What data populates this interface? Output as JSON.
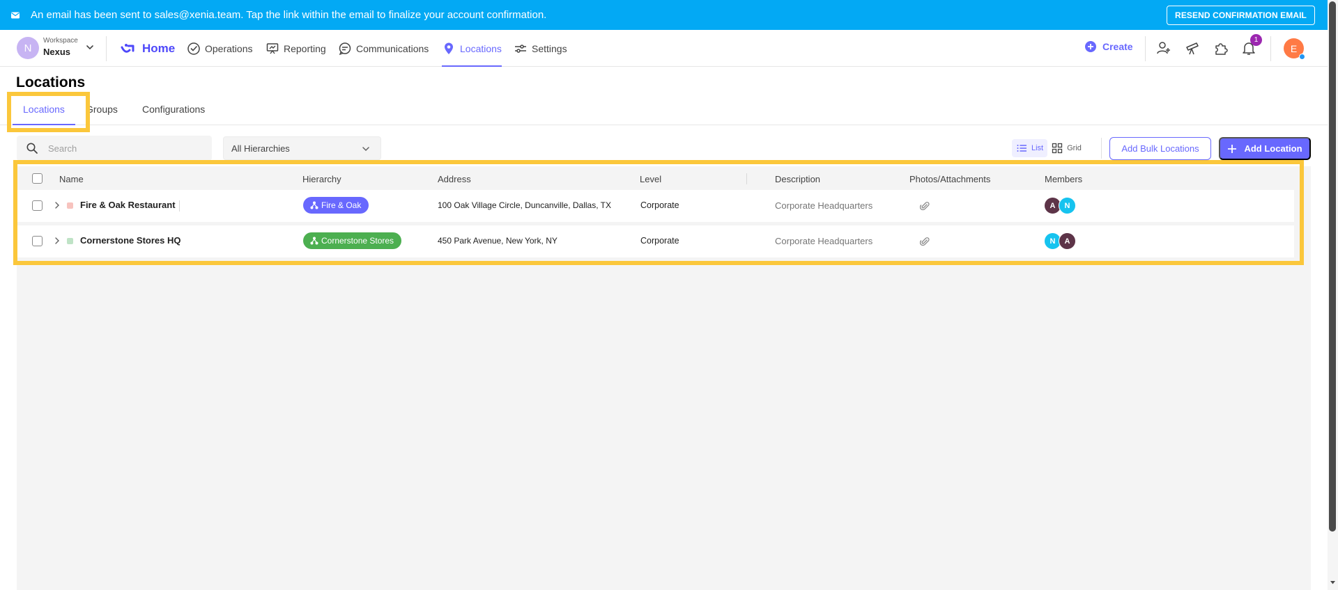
{
  "banner": {
    "message": "An email has been sent to sales@xenia.team. Tap the link within the email to finalize your account confirmation.",
    "resend_label": "RESEND CONFIRMATION EMAIL"
  },
  "workspace": {
    "label": "Workspace",
    "name": "Nexus",
    "initial": "N"
  },
  "nav": {
    "home": "Home",
    "items": [
      "Operations",
      "Reporting",
      "Communications",
      "Locations",
      "Settings"
    ]
  },
  "toprt": {
    "create": "Create",
    "notification_count": "1",
    "user_initial": "E"
  },
  "page": {
    "title": "Locations",
    "tabs": [
      "Locations",
      "Groups",
      "Configurations"
    ],
    "active_tab": "Locations"
  },
  "toolbar": {
    "search_placeholder": "Search",
    "hierarchy_value": "All Hierarchies",
    "view_list": "List",
    "view_grid": "Grid",
    "bulk_label": "Add Bulk Locations",
    "add_label": "Add Location"
  },
  "table": {
    "columns": [
      "Name",
      "Hierarchy",
      "Address",
      "Level",
      "Description",
      "Photos/Attachments",
      "Members"
    ],
    "rows": [
      {
        "name": "Fire & Oak Restaurant",
        "hierarchy": "Fire & Oak",
        "address": "100 Oak Village Circle, Duncanville, Dallas, TX",
        "level": "Corporate",
        "description": "Corporate Headquarters",
        "members": [
          "A",
          "N"
        ]
      },
      {
        "name": "Cornerstone Stores HQ",
        "hierarchy": "Cornerstone Stores",
        "address": "450 Park Avenue, New York, NY",
        "level": "Corporate",
        "description": "Corporate Headquarters",
        "members": [
          "N",
          "A"
        ]
      }
    ]
  },
  "colors": {
    "banner": "#03A9F4",
    "accent": "#6868FE",
    "highlight": "#FBC73B",
    "pill_fire_oak": "#6868FE",
    "pill_cornerstone": "#4CAF50",
    "avatar_a": "#5D3448",
    "avatar_n": "#16C3EF"
  }
}
